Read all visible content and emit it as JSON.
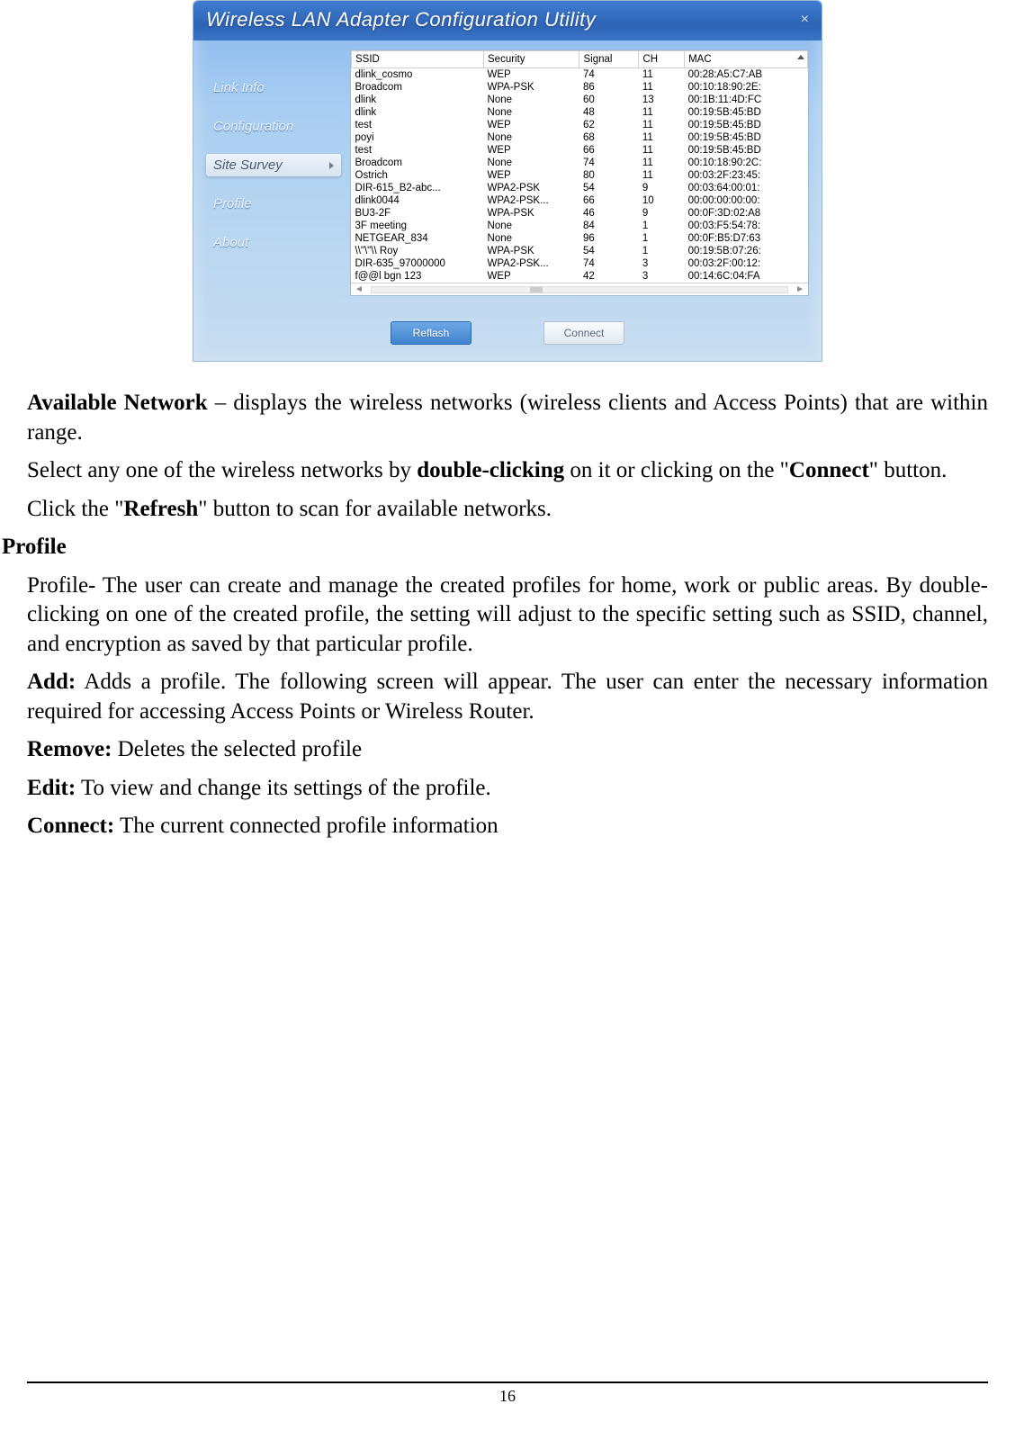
{
  "app": {
    "title": "Wireless LAN Adapter Configuration Utility",
    "close_symbol": "×",
    "nav": {
      "link_info": "Link Info",
      "configuration": "Configuration",
      "site_survey": "Site Survey",
      "profile": "Profile",
      "about": "About"
    },
    "table": {
      "columns": {
        "ssid": "SSID",
        "security": "Security",
        "signal": "Signal",
        "ch": "CH",
        "mac": "MAC"
      },
      "rows": [
        {
          "ssid": "dlink_cosmo",
          "security": "WEP",
          "signal": "74",
          "ch": "11",
          "mac": "00:28:A5:C7:AB"
        },
        {
          "ssid": "Broadcom",
          "security": "WPA-PSK",
          "signal": "86",
          "ch": "11",
          "mac": "00:10:18:90:2E:"
        },
        {
          "ssid": "dlink",
          "security": "None",
          "signal": "60",
          "ch": "13",
          "mac": "00:1B:11:4D:FC"
        },
        {
          "ssid": "dlink",
          "security": "None",
          "signal": "48",
          "ch": "11",
          "mac": "00:19:5B:45:BD"
        },
        {
          "ssid": "test",
          "security": "WEP",
          "signal": "62",
          "ch": "11",
          "mac": "00:19:5B:45:BD"
        },
        {
          "ssid": "poyi",
          "security": "None",
          "signal": "68",
          "ch": "11",
          "mac": "00:19:5B:45:BD"
        },
        {
          "ssid": "test",
          "security": "WEP",
          "signal": "66",
          "ch": "11",
          "mac": "00:19:5B:45:BD"
        },
        {
          "ssid": "Broadcom",
          "security": "None",
          "signal": "74",
          "ch": "11",
          "mac": "00:10:18:90:2C:"
        },
        {
          "ssid": "Ostrich",
          "security": "WEP",
          "signal": "80",
          "ch": "11",
          "mac": "00:03:2F:23:45:"
        },
        {
          "ssid": "DIR-615_B2-abc...",
          "security": "WPA2-PSK",
          "signal": "54",
          "ch": "9",
          "mac": "00:03:64:00:01:"
        },
        {
          "ssid": "dlink0044",
          "security": "WPA2-PSK...",
          "signal": "66",
          "ch": "10",
          "mac": "00:00:00:00:00:"
        },
        {
          "ssid": "BU3-2F",
          "security": "WPA-PSK",
          "signal": "46",
          "ch": "9",
          "mac": "00:0F:3D:02:A8"
        },
        {
          "ssid": "3F meeting",
          "security": "None",
          "signal": "84",
          "ch": "1",
          "mac": "00:03:F5:54:78:"
        },
        {
          "ssid": "NETGEAR_834",
          "security": "None",
          "signal": "96",
          "ch": "1",
          "mac": "00:0F:B5:D7:63"
        },
        {
          "ssid": "\\\\\"\\\"\\\\    Roy",
          "security": "WPA-PSK",
          "signal": "54",
          "ch": "1",
          "mac": "00:19:5B:07:26:"
        },
        {
          "ssid": "DIR-635_97000000",
          "security": "WPA2-PSK...",
          "signal": "74",
          "ch": "3",
          "mac": "00:03:2F:00:12:"
        },
        {
          "ssid": "f@@l bgn 123",
          "security": "WEP",
          "signal": "42",
          "ch": "3",
          "mac": "00:14:6C:04:FA"
        }
      ]
    },
    "buttons": {
      "reflash": "Reflash",
      "connect": "Connect"
    },
    "scroll": {
      "left": "◄",
      "right": "►"
    }
  },
  "doc": {
    "available_network_label": "Available Network",
    "available_network_body": " – displays the wireless networks (wireless clients and Access Points) that are within range.",
    "select_pre": "Select any one of the wireless networks by ",
    "double_clicking": "double-clicking",
    "select_post": " on it or clicking on the \"",
    "connect_bold": "Connect",
    "select_suffix": "\" button.",
    "refresh_pre": "Click the \"",
    "refresh_bold": "Refresh",
    "refresh_post": "\" button to scan for available networks.",
    "profile_heading": "Profile",
    "profile_body": "Profile- The user can create and manage the created profiles for home, work or public areas. By double-clicking on one of the created profile, the setting will adjust to the specific setting such as SSID, channel, and encryption as saved by that particular profile.",
    "add_label": "Add:",
    "add_body": " Adds a profile. The following screen will appear. The user can enter the necessary information required for accessing Access Points or Wireless Router.",
    "remove_label": "Remove:",
    "remove_body": " Deletes the selected profile",
    "edit_label": "Edit:",
    "edit_body": " To view and change its settings of the profile.",
    "connect_label": "Connect:",
    "connect_body": " The current connected profile information"
  },
  "page_number": "16"
}
